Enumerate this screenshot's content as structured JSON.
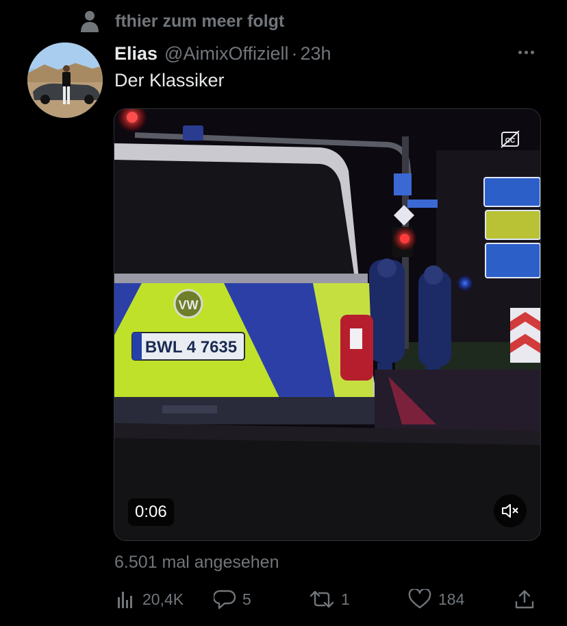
{
  "social_context": {
    "text": "fthier zum meer folgt",
    "icon": "person-icon"
  },
  "tweet": {
    "author_name": "Elias",
    "author_handle": "@AimixOffiziell",
    "separator": "·",
    "time": "23h",
    "text": "Der Klassiker"
  },
  "media": {
    "duration": "0:06",
    "plate_text": "BWL 4 7635",
    "cc_icon": "closed-captions-off-icon",
    "mute_icon": "speaker-muted-icon"
  },
  "views": "6.501 mal angesehen",
  "actions": {
    "views_count": "20,4K",
    "replies": "5",
    "retweets": "1",
    "likes": "184"
  },
  "colors": {
    "background": "#000000",
    "primary_text": "#e7e9ea",
    "secondary_text": "#71767b",
    "border": "#2f3336"
  }
}
